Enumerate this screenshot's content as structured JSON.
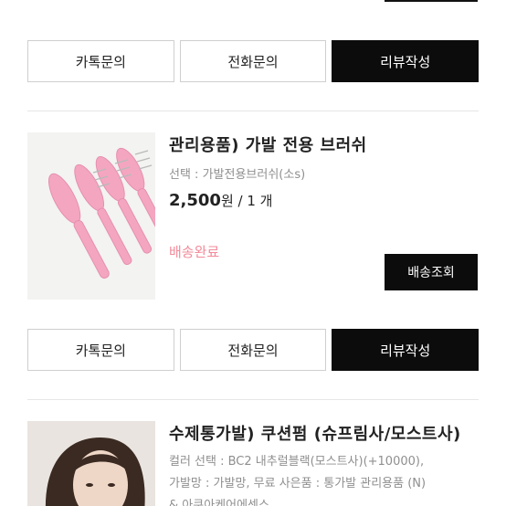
{
  "orders": [
    {
      "buttons": {
        "kakao": "카톡문의",
        "phone": "전화문의",
        "review": "리뷰작성"
      }
    },
    {
      "title": "관리용품) 가발 전용 브러쉬",
      "option": "선택 : 가발전용브러쉬(소s)",
      "price": "2,500",
      "price_unit": "원 / 1 개",
      "status": "배송완료",
      "track_label": "배송조회",
      "buttons": {
        "kakao": "카톡문의",
        "phone": "전화문의",
        "review": "리뷰작성"
      }
    },
    {
      "title": "수제통가발) 쿠션펌 (슈프림사/모스트사)",
      "option_line1": "컬러 선택 : BC2 내추럴블랙(모스트사)(+10000),",
      "option_line2": "가발망 : 가발망, 무료 사은품 : 통가발 관리용품 (N)",
      "option_line3": "& 아쿠아케어에센스"
    }
  ],
  "colors": {
    "accent": "#0c0c0c",
    "status": "#f28b9a",
    "border": "#cfcfcf",
    "muted": "#8f8f8f"
  }
}
